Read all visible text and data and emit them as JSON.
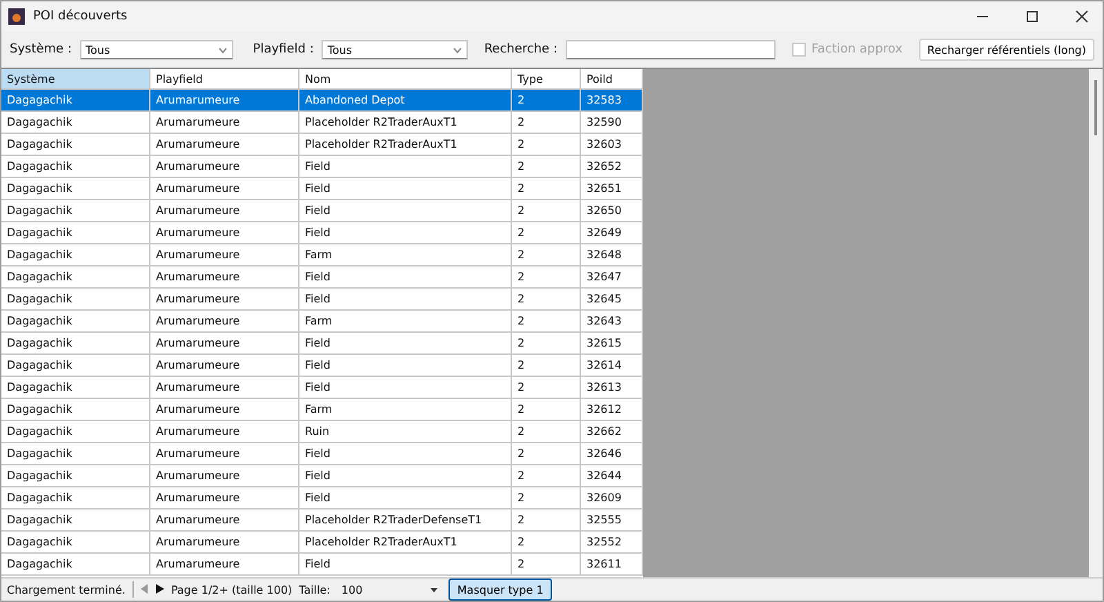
{
  "window": {
    "title": "POI découverts"
  },
  "filters": {
    "system_label": "Système :",
    "system_value": "Tous",
    "playfield_label": "Playfield :",
    "playfield_value": "Tous",
    "search_label": "Recherche :",
    "faction_approx": {
      "label": "Faction approx",
      "checked": false,
      "disabled": true
    },
    "reload_button": "Recharger référentiels (long)"
  },
  "table": {
    "columns": [
      {
        "label": "Système",
        "selected": true
      },
      {
        "label": "Playfield",
        "selected": false
      },
      {
        "label": "Nom",
        "selected": false
      },
      {
        "label": "Type",
        "selected": false
      },
      {
        "label": "Poild",
        "selected": false
      }
    ],
    "rows": [
      {
        "cells": [
          "Dagagachik",
          "Arumarumeure",
          "Abandoned Depot",
          "2",
          "32583"
        ],
        "selected": true
      },
      {
        "cells": [
          "Dagagachik",
          "Arumarumeure",
          "Placeholder R2TraderAuxT1",
          "2",
          "32590"
        ],
        "selected": false
      },
      {
        "cells": [
          "Dagagachik",
          "Arumarumeure",
          "Placeholder R2TraderAuxT1",
          "2",
          "32603"
        ],
        "selected": false
      },
      {
        "cells": [
          "Dagagachik",
          "Arumarumeure",
          "Field",
          "2",
          "32652"
        ],
        "selected": false
      },
      {
        "cells": [
          "Dagagachik",
          "Arumarumeure",
          "Field",
          "2",
          "32651"
        ],
        "selected": false
      },
      {
        "cells": [
          "Dagagachik",
          "Arumarumeure",
          "Field",
          "2",
          "32650"
        ],
        "selected": false
      },
      {
        "cells": [
          "Dagagachik",
          "Arumarumeure",
          "Field",
          "2",
          "32649"
        ],
        "selected": false
      },
      {
        "cells": [
          "Dagagachik",
          "Arumarumeure",
          "Farm",
          "2",
          "32648"
        ],
        "selected": false
      },
      {
        "cells": [
          "Dagagachik",
          "Arumarumeure",
          "Field",
          "2",
          "32647"
        ],
        "selected": false
      },
      {
        "cells": [
          "Dagagachik",
          "Arumarumeure",
          "Field",
          "2",
          "32645"
        ],
        "selected": false
      },
      {
        "cells": [
          "Dagagachik",
          "Arumarumeure",
          "Farm",
          "2",
          "32643"
        ],
        "selected": false
      },
      {
        "cells": [
          "Dagagachik",
          "Arumarumeure",
          "Field",
          "2",
          "32615"
        ],
        "selected": false
      },
      {
        "cells": [
          "Dagagachik",
          "Arumarumeure",
          "Field",
          "2",
          "32614"
        ],
        "selected": false
      },
      {
        "cells": [
          "Dagagachik",
          "Arumarumeure",
          "Field",
          "2",
          "32613"
        ],
        "selected": false
      },
      {
        "cells": [
          "Dagagachik",
          "Arumarumeure",
          "Farm",
          "2",
          "32612"
        ],
        "selected": false
      },
      {
        "cells": [
          "Dagagachik",
          "Arumarumeure",
          "Ruin",
          "2",
          "32662"
        ],
        "selected": false
      },
      {
        "cells": [
          "Dagagachik",
          "Arumarumeure",
          "Field",
          "2",
          "32646"
        ],
        "selected": false
      },
      {
        "cells": [
          "Dagagachik",
          "Arumarumeure",
          "Field",
          "2",
          "32644"
        ],
        "selected": false
      },
      {
        "cells": [
          "Dagagachik",
          "Arumarumeure",
          "Field",
          "2",
          "32609"
        ],
        "selected": false
      },
      {
        "cells": [
          "Dagagachik",
          "Arumarumeure",
          "Placeholder R2TraderDefenseT1",
          "2",
          "32555"
        ],
        "selected": false
      },
      {
        "cells": [
          "Dagagachik",
          "Arumarumeure",
          "Placeholder R2TraderAuxT1",
          "2",
          "32552"
        ],
        "selected": false
      },
      {
        "cells": [
          "Dagagachik",
          "Arumarumeure",
          "Field",
          "2",
          "32611"
        ],
        "selected": false
      }
    ]
  },
  "status_bar": {
    "message": "Chargement terminé.",
    "page": "Page 1/2+ (taille 100)",
    "size_label": "Taille:",
    "size_value": "100",
    "hide_type_button": {
      "label": "Masquer type 1",
      "pressed": true
    }
  }
}
